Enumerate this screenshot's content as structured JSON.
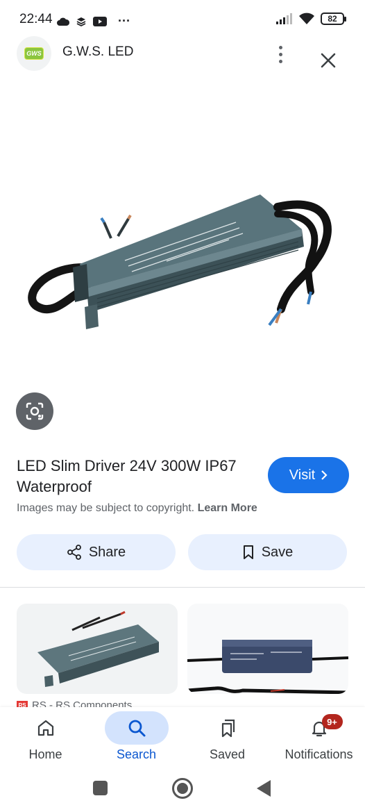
{
  "status_bar": {
    "time": "22:44",
    "more": "···",
    "battery": "82",
    "icons": [
      "cloud-icon",
      "stack-icon",
      "youtube-icon",
      "signal-icon",
      "wifi-icon",
      "battery-icon"
    ]
  },
  "header": {
    "logo_text": "GWS",
    "site_name": "G.W.S. LED"
  },
  "product": {
    "title": "LED Slim Driver 24V 300W IP67 Waterproof",
    "visit_label": "Visit",
    "copyright_text": "Images may be subject to copyright.",
    "learn_more": "Learn More"
  },
  "actions": {
    "share_label": "Share",
    "save_label": "Save"
  },
  "related": {
    "source_logo": "RS",
    "source_text": "RS - RS Components"
  },
  "bottom_nav": {
    "items": [
      {
        "label": "Home",
        "icon": "home-icon"
      },
      {
        "label": "Search",
        "icon": "search-icon"
      },
      {
        "label": "Saved",
        "icon": "bookmarks-icon"
      },
      {
        "label": "Notifications",
        "icon": "bell-icon",
        "badge": "9+"
      }
    ],
    "active_index": 1
  },
  "colors": {
    "accent": "#1a73e8",
    "pill_bg": "#e8f0fe",
    "active_tab_bg": "#d3e3fd",
    "badge": "#b3261e",
    "product_body": "#4f6a72"
  }
}
